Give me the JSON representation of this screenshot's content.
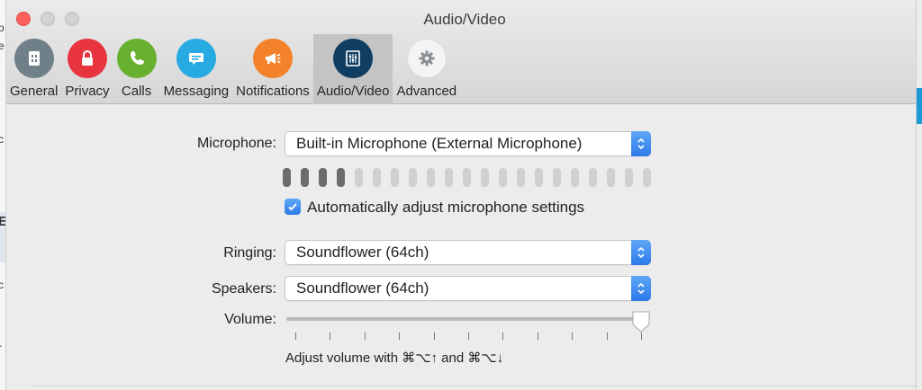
{
  "window": {
    "title": "Audio/Video"
  },
  "tabs": [
    {
      "label": "General",
      "color": "#6f8089",
      "icon": "general-icon"
    },
    {
      "label": "Privacy",
      "color": "#e8343f",
      "icon": "lock-icon"
    },
    {
      "label": "Calls",
      "color": "#68b030",
      "icon": "phone-icon"
    },
    {
      "label": "Messaging",
      "color": "#27a9e1",
      "icon": "chat-bubble-icon"
    },
    {
      "label": "Notifications",
      "color": "#f4822b",
      "icon": "megaphone-icon"
    },
    {
      "label": "Audio/Video",
      "color": "#0f3e62",
      "icon": "equalizer-icon",
      "active": true
    },
    {
      "label": "Advanced",
      "color": "#f4f4f4",
      "icon": "gear-icon"
    }
  ],
  "audio": {
    "microphone_label": "Microphone:",
    "microphone_value": "Built-in Microphone (External Microphone)",
    "level": {
      "active_segments": 4,
      "total_segments": 21
    },
    "auto_adjust_label": "Automatically adjust microphone settings",
    "auto_adjust_checked": true,
    "ringing_label": "Ringing:",
    "ringing_value": "Soundflower (64ch)",
    "speakers_label": "Speakers:",
    "speakers_value": "Soundflower (64ch)",
    "volume_label": "Volume:",
    "volume_level": 1.0,
    "volume_hint": "Adjust volume with ⌘⌥↑ and ⌘⌥↓"
  },
  "colors": {
    "accent": "#2d7ae9",
    "active_tab": "#c4c4c4"
  }
}
